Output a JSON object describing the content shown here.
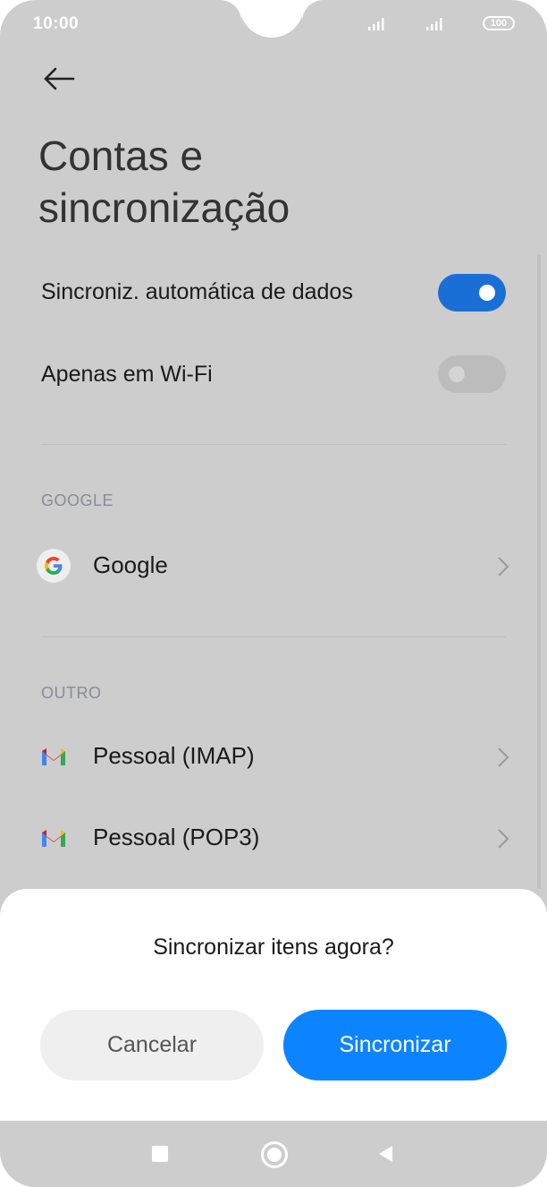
{
  "status": {
    "time": "10:00",
    "battery": "100"
  },
  "page": {
    "title_line1": "Contas e",
    "title_line2": "sincronização"
  },
  "settings": {
    "auto_sync_label": "Sincroniz. automática de dados",
    "auto_sync_on": true,
    "wifi_only_label": "Apenas em Wi-Fi",
    "wifi_only_on": false
  },
  "sections": {
    "google_header": "GOOGLE",
    "google_account": "Google",
    "other_header": "OUTRO",
    "accounts": [
      {
        "label": "Pessoal (IMAP)"
      },
      {
        "label": "Pessoal (POP3)"
      }
    ]
  },
  "dialog": {
    "title": "Sincronizar itens agora?",
    "cancel_label": "Cancelar",
    "confirm_label": "Sincronizar"
  },
  "colors": {
    "accent": "#0d84ff",
    "toggle_on": "#1a6fd6",
    "toggle_off": "#bcbcbc"
  }
}
